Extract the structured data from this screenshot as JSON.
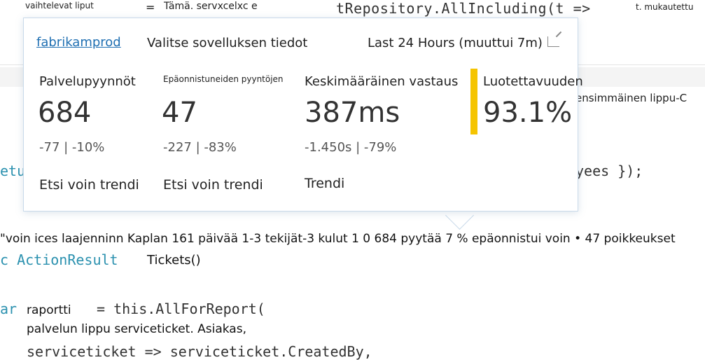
{
  "code_bg": {
    "top_left_label": "vaihtelevat liput",
    "top_mid_label": "Tämä. servxcelxc e",
    "top_eq": "=",
    "top_code": "tRepository.AllIncluding(t =>",
    "top_right_label": "t. mukautettu",
    "right_side_label": "ensimmäinen lippu-C",
    "left_fragment_1": "etu",
    "right_fragment_1": "yees });",
    "codelens_text": "\"voin ices laajenninn Kaplan 161 päivää 1-3 tekijät-3 kulut 1 0 684 pyytää 7 % epäonnistui voin • 47 poikkeukset",
    "action_prefix": "c ActionResult",
    "action_name": "Tickets()",
    "var_prefix": "ar",
    "var_name": "raportti",
    "var_eq": "= this.AllForReport(",
    "line_service": "palvelun lippu serviceticket. Asiakas,",
    "line_last": "serviceticket => serviceticket.CreatedBy,"
  },
  "popup": {
    "app_link": "fabrikamprod",
    "header_title": "Valitse sovelluksen tiedot",
    "time_range": "Last 24 Hours (muuttui 7m)",
    "metrics": [
      {
        "title": "Palvelupyynnöt",
        "value": "684",
        "delta": "-77 | -10%",
        "trend": "Etsi voin trendi"
      },
      {
        "title": "Epäonnistuneiden pyyntöjen",
        "value": "47",
        "delta": "-227 | -83%",
        "trend": "Etsi voin trendi"
      },
      {
        "title": "Keskimääräinen vastaus",
        "value": "387ms",
        "delta": "-1.450s | -79%",
        "trend": "Trendi"
      },
      {
        "title": "Luotettavuuden",
        "value": "93.1%"
      }
    ],
    "accent_color": "#f5c400",
    "link_color": "#1f6fb2"
  }
}
